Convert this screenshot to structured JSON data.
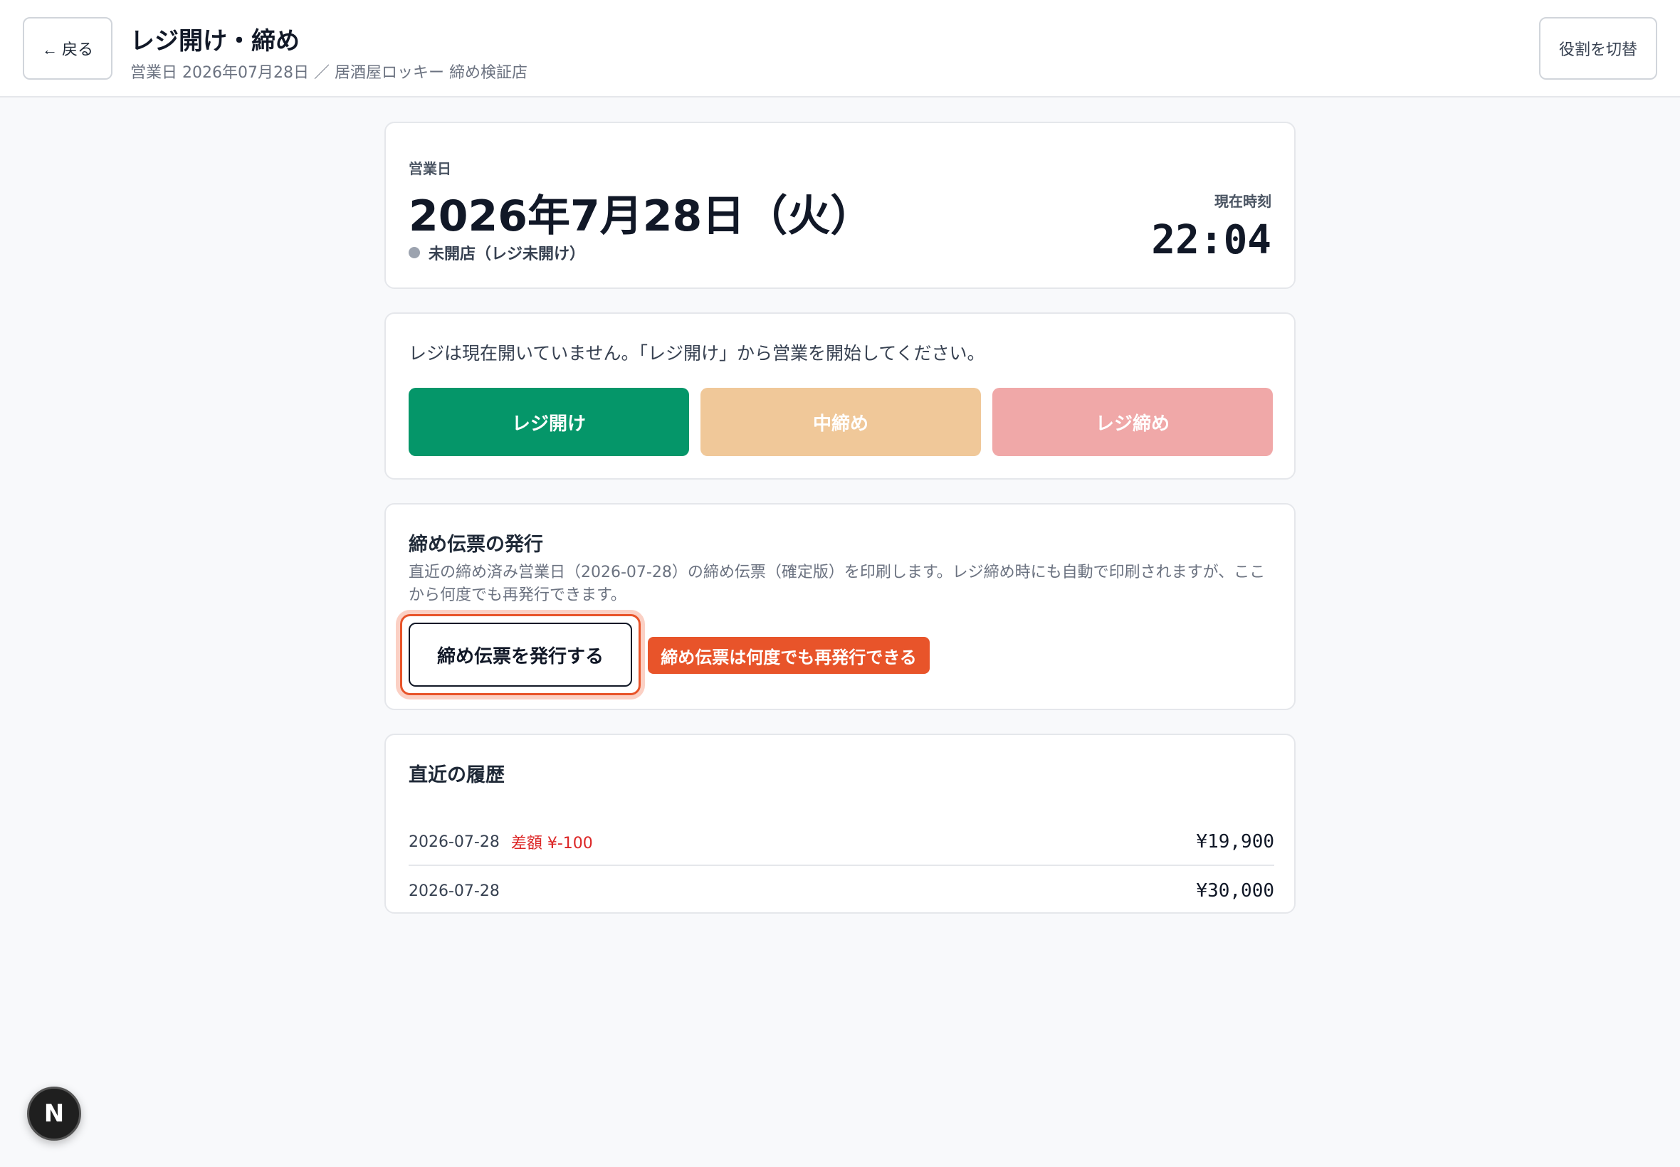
{
  "header": {
    "back_label": "← 戻る",
    "title": "レジ開け・締め",
    "subtitle": "営業日 2026年07月28日 ／ 居酒屋ロッキー 締め検証店",
    "role_switch_label": "役割を切替"
  },
  "business_day": {
    "label": "営業日",
    "date": "2026年7月28日（火）",
    "status": "未開店（レジ未開け）",
    "status_color": "#9ca3af",
    "time_label": "現在時刻",
    "time": "22:04"
  },
  "register_actions": {
    "notice": "レジは現在開いていません。「レジ開け」から営業を開始してください。",
    "open_label": "レジ開け",
    "mid_close_label": "中締め",
    "close_label": "レジ締め",
    "colors": {
      "open": "#059669",
      "mid_close": "#f0c899",
      "close": "#f0a8a8"
    }
  },
  "closing_slip": {
    "title": "締め伝票の発行",
    "description": "直近の締め済み営業日（2026-07-28）の締め伝票（確定版）を印刷します。レジ締め時にも自動で印刷されますが、ここから何度でも再発行できます。",
    "issue_label": "締め伝票を発行する",
    "tip": "締め伝票は何度でも再発行できる",
    "accent_color": "#e8542a"
  },
  "history": {
    "title": "直近の履歴",
    "rows": [
      {
        "date": "2026-07-28",
        "diff": "差額 ¥-100",
        "amount": "¥19,900"
      },
      {
        "date": "2026-07-28",
        "diff": "",
        "amount": "¥30,000"
      }
    ]
  },
  "dev_badge": {
    "letter": "N"
  }
}
